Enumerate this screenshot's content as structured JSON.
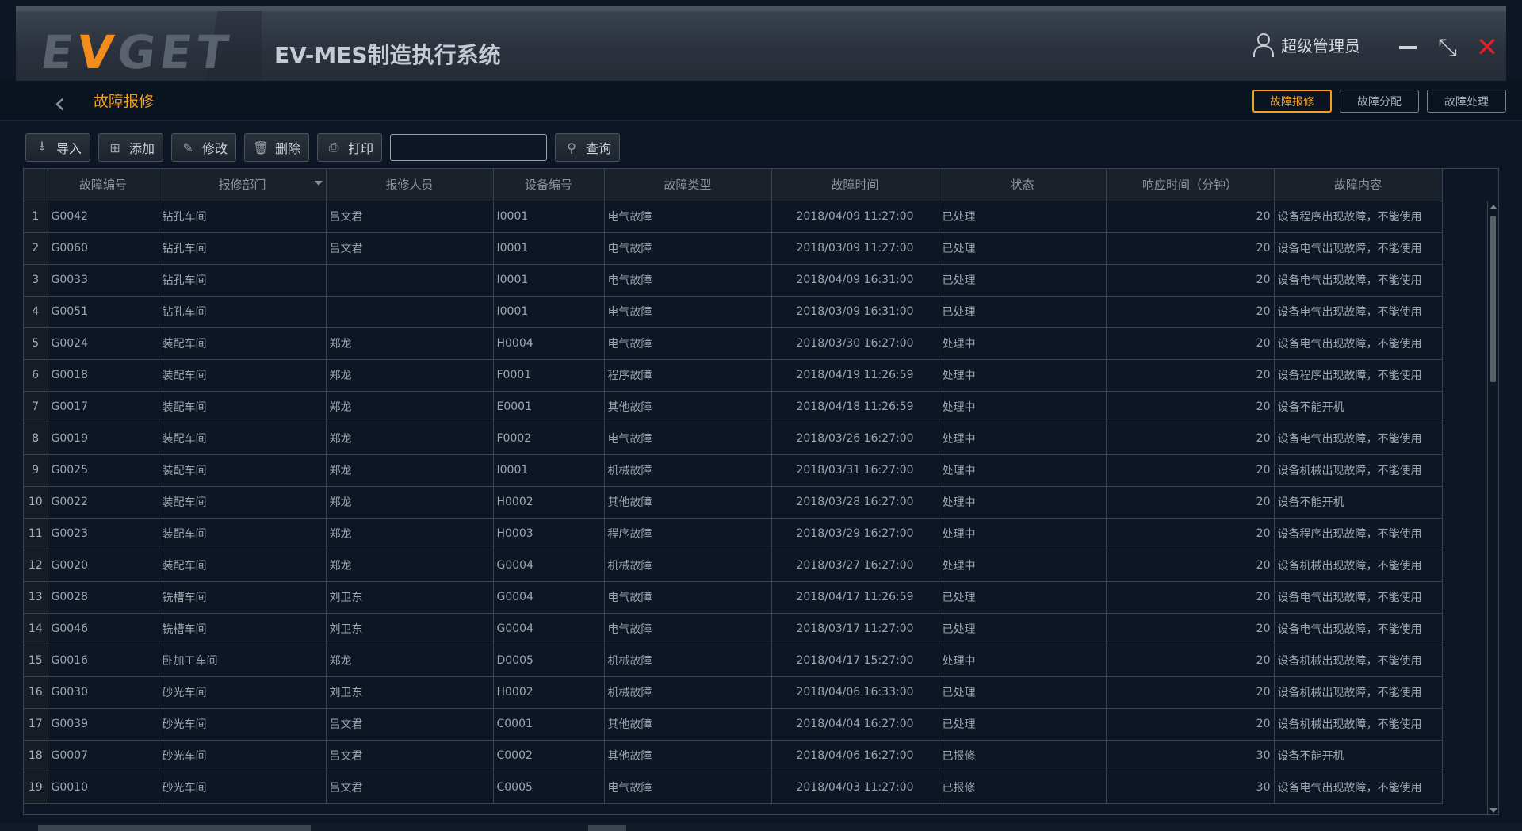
{
  "header": {
    "logo_prefix": "E",
    "logo_v": "V",
    "logo_suffix": "GET",
    "app_title": "EV-MES制造执行系统",
    "user_name": "超级管理员",
    "restore_glyph": "⤡",
    "close_glyph": "✕"
  },
  "subbar": {
    "back_glyph": "‹",
    "page_title": "故障报修",
    "tabs": [
      "故障报修",
      "故障分配",
      "故障处理"
    ]
  },
  "toolbar": {
    "import_label": "导入",
    "add_label": "添加",
    "edit_label": "修改",
    "delete_label": "删除",
    "print_label": "打印",
    "search_value": "",
    "query_label": "查询"
  },
  "icons": {
    "import": "download-icon",
    "add": "plus-icon",
    "edit": "pencil-icon",
    "delete": "trash-icon",
    "print": "printer-icon",
    "query": "search-icon"
  },
  "colors": {
    "accent": "#f2a01e",
    "logo_v": "#f28c1c",
    "close": "#e0202a",
    "background": "#0c1624"
  },
  "table": {
    "columns": [
      "故障编号",
      "报修部门",
      "报修人员",
      "设备编号",
      "故障类型",
      "故障时间",
      "状态",
      "响应时间（分钟）",
      "故障内容"
    ],
    "rows": [
      [
        "1",
        "G0042",
        "钻孔车间",
        "吕文君",
        "I0001",
        "电气故障",
        "2018/04/09 11:27:00",
        "已处理",
        "20",
        "设备程序出现故障，不能使用"
      ],
      [
        "2",
        "G0060",
        "钻孔车间",
        "吕文君",
        "I0001",
        "电气故障",
        "2018/03/09 11:27:00",
        "已处理",
        "20",
        "设备电气出现故障，不能使用"
      ],
      [
        "3",
        "G0033",
        "钻孔车间",
        "",
        "I0001",
        "电气故障",
        "2018/04/09 16:31:00",
        "已处理",
        "20",
        "设备电气出现故障，不能使用"
      ],
      [
        "4",
        "G0051",
        "钻孔车间",
        "",
        "I0001",
        "电气故障",
        "2018/03/09 16:31:00",
        "已处理",
        "20",
        "设备电气出现故障，不能使用"
      ],
      [
        "5",
        "G0024",
        "装配车间",
        "郑龙",
        "H0004",
        "电气故障",
        "2018/03/30 16:27:00",
        "处理中",
        "20",
        "设备电气出现故障，不能使用"
      ],
      [
        "6",
        "G0018",
        "装配车间",
        "郑龙",
        "F0001",
        "程序故障",
        "2018/04/19 11:26:59",
        "处理中",
        "20",
        "设备程序出现故障，不能使用"
      ],
      [
        "7",
        "G0017",
        "装配车间",
        "郑龙",
        "E0001",
        "其他故障",
        "2018/04/18 11:26:59",
        "处理中",
        "20",
        "设备不能开机"
      ],
      [
        "8",
        "G0019",
        "装配车间",
        "郑龙",
        "F0002",
        "电气故障",
        "2018/03/26 16:27:00",
        "处理中",
        "20",
        "设备电气出现故障，不能使用"
      ],
      [
        "9",
        "G0025",
        "装配车间",
        "郑龙",
        "I0001",
        "机械故障",
        "2018/03/31 16:27:00",
        "处理中",
        "20",
        "设备机械出现故障，不能使用"
      ],
      [
        "10",
        "G0022",
        "装配车间",
        "郑龙",
        "H0002",
        "其他故障",
        "2018/03/28 16:27:00",
        "处理中",
        "20",
        "设备不能开机"
      ],
      [
        "11",
        "G0023",
        "装配车间",
        "郑龙",
        "H0003",
        "程序故障",
        "2018/03/29 16:27:00",
        "处理中",
        "20",
        "设备程序出现故障，不能使用"
      ],
      [
        "12",
        "G0020",
        "装配车间",
        "郑龙",
        "G0004",
        "机械故障",
        "2018/03/27 16:27:00",
        "处理中",
        "20",
        "设备机械出现故障，不能使用"
      ],
      [
        "13",
        "G0028",
        "铣槽车间",
        "刘卫东",
        "G0004",
        "电气故障",
        "2018/04/17 11:26:59",
        "已处理",
        "20",
        "设备电气出现故障，不能使用"
      ],
      [
        "14",
        "G0046",
        "铣槽车间",
        "刘卫东",
        "G0004",
        "电气故障",
        "2018/03/17 11:27:00",
        "已处理",
        "20",
        "设备电气出现故障，不能使用"
      ],
      [
        "15",
        "G0016",
        "卧加工车间",
        "郑龙",
        "D0005",
        "机械故障",
        "2018/04/17 15:27:00",
        "处理中",
        "20",
        "设备机械出现故障，不能使用"
      ],
      [
        "16",
        "G0030",
        "砂光车间",
        "刘卫东",
        "H0002",
        "机械故障",
        "2018/04/06 16:33:00",
        "已处理",
        "20",
        "设备机械出现故障，不能使用"
      ],
      [
        "17",
        "G0039",
        "砂光车间",
        "吕文君",
        "C0001",
        "其他故障",
        "2018/04/04 16:27:00",
        "已处理",
        "20",
        "设备机械出现故障，不能使用"
      ],
      [
        "18",
        "G0007",
        "砂光车间",
        "吕文君",
        "C0002",
        "其他故障",
        "2018/04/06 16:27:00",
        "已报修",
        "30",
        "设备不能开机"
      ],
      [
        "19",
        "G0010",
        "砂光车间",
        "吕文君",
        "C0005",
        "电气故障",
        "2018/04/03 11:27:00",
        "已报修",
        "30",
        "设备电气出现故障，不能使用"
      ]
    ]
  }
}
